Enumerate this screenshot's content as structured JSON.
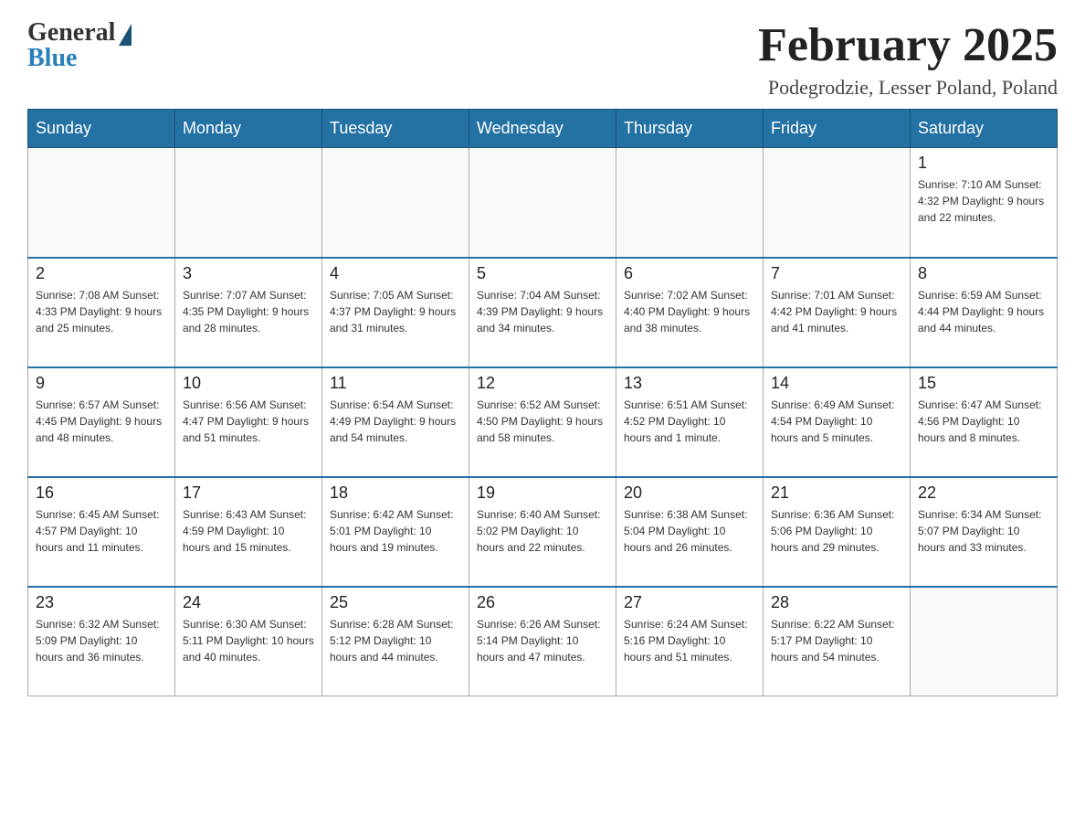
{
  "logo": {
    "general": "General",
    "blue": "Blue"
  },
  "header": {
    "month": "February 2025",
    "location": "Podegrodzie, Lesser Poland, Poland"
  },
  "weekdays": [
    "Sunday",
    "Monday",
    "Tuesday",
    "Wednesday",
    "Thursday",
    "Friday",
    "Saturday"
  ],
  "weeks": [
    [
      {
        "day": "",
        "info": ""
      },
      {
        "day": "",
        "info": ""
      },
      {
        "day": "",
        "info": ""
      },
      {
        "day": "",
        "info": ""
      },
      {
        "day": "",
        "info": ""
      },
      {
        "day": "",
        "info": ""
      },
      {
        "day": "1",
        "info": "Sunrise: 7:10 AM\nSunset: 4:32 PM\nDaylight: 9 hours and 22 minutes."
      }
    ],
    [
      {
        "day": "2",
        "info": "Sunrise: 7:08 AM\nSunset: 4:33 PM\nDaylight: 9 hours and 25 minutes."
      },
      {
        "day": "3",
        "info": "Sunrise: 7:07 AM\nSunset: 4:35 PM\nDaylight: 9 hours and 28 minutes."
      },
      {
        "day": "4",
        "info": "Sunrise: 7:05 AM\nSunset: 4:37 PM\nDaylight: 9 hours and 31 minutes."
      },
      {
        "day": "5",
        "info": "Sunrise: 7:04 AM\nSunset: 4:39 PM\nDaylight: 9 hours and 34 minutes."
      },
      {
        "day": "6",
        "info": "Sunrise: 7:02 AM\nSunset: 4:40 PM\nDaylight: 9 hours and 38 minutes."
      },
      {
        "day": "7",
        "info": "Sunrise: 7:01 AM\nSunset: 4:42 PM\nDaylight: 9 hours and 41 minutes."
      },
      {
        "day": "8",
        "info": "Sunrise: 6:59 AM\nSunset: 4:44 PM\nDaylight: 9 hours and 44 minutes."
      }
    ],
    [
      {
        "day": "9",
        "info": "Sunrise: 6:57 AM\nSunset: 4:45 PM\nDaylight: 9 hours and 48 minutes."
      },
      {
        "day": "10",
        "info": "Sunrise: 6:56 AM\nSunset: 4:47 PM\nDaylight: 9 hours and 51 minutes."
      },
      {
        "day": "11",
        "info": "Sunrise: 6:54 AM\nSunset: 4:49 PM\nDaylight: 9 hours and 54 minutes."
      },
      {
        "day": "12",
        "info": "Sunrise: 6:52 AM\nSunset: 4:50 PM\nDaylight: 9 hours and 58 minutes."
      },
      {
        "day": "13",
        "info": "Sunrise: 6:51 AM\nSunset: 4:52 PM\nDaylight: 10 hours and 1 minute."
      },
      {
        "day": "14",
        "info": "Sunrise: 6:49 AM\nSunset: 4:54 PM\nDaylight: 10 hours and 5 minutes."
      },
      {
        "day": "15",
        "info": "Sunrise: 6:47 AM\nSunset: 4:56 PM\nDaylight: 10 hours and 8 minutes."
      }
    ],
    [
      {
        "day": "16",
        "info": "Sunrise: 6:45 AM\nSunset: 4:57 PM\nDaylight: 10 hours and 11 minutes."
      },
      {
        "day": "17",
        "info": "Sunrise: 6:43 AM\nSunset: 4:59 PM\nDaylight: 10 hours and 15 minutes."
      },
      {
        "day": "18",
        "info": "Sunrise: 6:42 AM\nSunset: 5:01 PM\nDaylight: 10 hours and 19 minutes."
      },
      {
        "day": "19",
        "info": "Sunrise: 6:40 AM\nSunset: 5:02 PM\nDaylight: 10 hours and 22 minutes."
      },
      {
        "day": "20",
        "info": "Sunrise: 6:38 AM\nSunset: 5:04 PM\nDaylight: 10 hours and 26 minutes."
      },
      {
        "day": "21",
        "info": "Sunrise: 6:36 AM\nSunset: 5:06 PM\nDaylight: 10 hours and 29 minutes."
      },
      {
        "day": "22",
        "info": "Sunrise: 6:34 AM\nSunset: 5:07 PM\nDaylight: 10 hours and 33 minutes."
      }
    ],
    [
      {
        "day": "23",
        "info": "Sunrise: 6:32 AM\nSunset: 5:09 PM\nDaylight: 10 hours and 36 minutes."
      },
      {
        "day": "24",
        "info": "Sunrise: 6:30 AM\nSunset: 5:11 PM\nDaylight: 10 hours and 40 minutes."
      },
      {
        "day": "25",
        "info": "Sunrise: 6:28 AM\nSunset: 5:12 PM\nDaylight: 10 hours and 44 minutes."
      },
      {
        "day": "26",
        "info": "Sunrise: 6:26 AM\nSunset: 5:14 PM\nDaylight: 10 hours and 47 minutes."
      },
      {
        "day": "27",
        "info": "Sunrise: 6:24 AM\nSunset: 5:16 PM\nDaylight: 10 hours and 51 minutes."
      },
      {
        "day": "28",
        "info": "Sunrise: 6:22 AM\nSunset: 5:17 PM\nDaylight: 10 hours and 54 minutes."
      },
      {
        "day": "",
        "info": ""
      }
    ]
  ]
}
